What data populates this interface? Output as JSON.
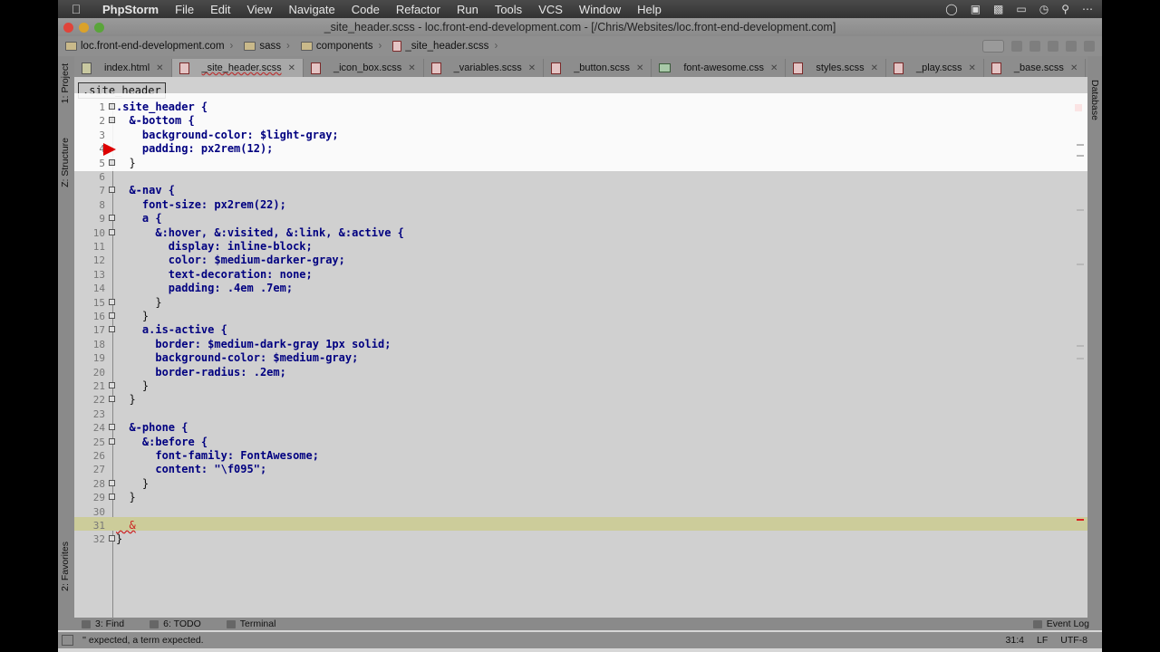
{
  "menubar": {
    "app_name": "PhpStorm",
    "items": [
      "File",
      "Edit",
      "View",
      "Navigate",
      "Code",
      "Refactor",
      "Run",
      "Tools",
      "VCS",
      "Window",
      "Help"
    ]
  },
  "window": {
    "title": "_site_header.scss - loc.front-end-development.com - [/Chris/Websites/loc.front-end-development.com]"
  },
  "breadcrumbs": [
    "loc.front-end-development.com",
    "sass",
    "components",
    "_site_header.scss"
  ],
  "left_panels": {
    "project": "1: Project",
    "structure": "Z: Structure",
    "favorites": "2: Favorites"
  },
  "right_panels": {
    "database": "Database"
  },
  "tabs": [
    {
      "label": "index.html",
      "icon": "html-file-icon"
    },
    {
      "label": "_site_header.scss",
      "icon": "scss-file-icon",
      "active": true
    },
    {
      "label": "_icon_box.scss",
      "icon": "scss-file-icon"
    },
    {
      "label": "_variables.scss",
      "icon": "scss-file-icon"
    },
    {
      "label": "_button.scss",
      "icon": "scss-file-icon"
    },
    {
      "label": "font-awesome.css",
      "icon": "css-file-icon"
    },
    {
      "label": "styles.scss",
      "icon": "scss-file-icon"
    },
    {
      "label": "_play.scss",
      "icon": "scss-file-icon"
    },
    {
      "label": "_base.scss",
      "icon": "scss-file-icon"
    }
  ],
  "editor": {
    "structure_crumb": ".site_header",
    "lines": [
      {
        "n": "1",
        "text": ".site_header {"
      },
      {
        "n": "2",
        "text": "  &-bottom {"
      },
      {
        "n": "3",
        "text": "    background-color: $light-gray;"
      },
      {
        "n": "4",
        "text": "    padding: px2rem(12);"
      },
      {
        "n": "5",
        "text": "  }"
      },
      {
        "n": "6",
        "text": ""
      },
      {
        "n": "7",
        "text": "  &-nav {"
      },
      {
        "n": "8",
        "text": "    font-size: px2rem(22);"
      },
      {
        "n": "9",
        "text": "    a {"
      },
      {
        "n": "10",
        "text": "      &:hover, &:visited, &:link, &:active {"
      },
      {
        "n": "11",
        "text": "        display: inline-block;"
      },
      {
        "n": "12",
        "text": "        color: $medium-darker-gray;"
      },
      {
        "n": "13",
        "text": "        text-decoration: none;"
      },
      {
        "n": "14",
        "text": "        padding: .4em .7em;"
      },
      {
        "n": "15",
        "text": "      }"
      },
      {
        "n": "16",
        "text": "    }"
      },
      {
        "n": "17",
        "text": "    a.is-active {"
      },
      {
        "n": "18",
        "text": "      border: $medium-dark-gray 1px solid;"
      },
      {
        "n": "19",
        "text": "      background-color: $medium-gray;"
      },
      {
        "n": "20",
        "text": "      border-radius: .2em;"
      },
      {
        "n": "21",
        "text": "    }"
      },
      {
        "n": "22",
        "text": "  }"
      },
      {
        "n": "23",
        "text": ""
      },
      {
        "n": "24",
        "text": "  &-phone {"
      },
      {
        "n": "25",
        "text": "    &:before {"
      },
      {
        "n": "26",
        "text": "      font-family: FontAwesome;"
      },
      {
        "n": "27",
        "text": "      content: \"\\f095\";"
      },
      {
        "n": "28",
        "text": "    }"
      },
      {
        "n": "29",
        "text": "  }"
      },
      {
        "n": "30",
        "text": ""
      },
      {
        "n": "31",
        "text": "  &"
      },
      {
        "n": "32",
        "text": "}"
      }
    ]
  },
  "toolwindows": {
    "find": "3: Find",
    "todo": "6: TODO",
    "terminal": "Terminal",
    "event_log": "Event Log"
  },
  "status": {
    "message": "'' expected, a term expected.",
    "position": "31:4",
    "line_sep": "LF",
    "encoding": "UTF-8"
  },
  "colors": {
    "error_red": "#dd2222",
    "keyword_blue": "#000080",
    "variable_purple": "#660e7a",
    "number_green": "#1e6b1e"
  }
}
